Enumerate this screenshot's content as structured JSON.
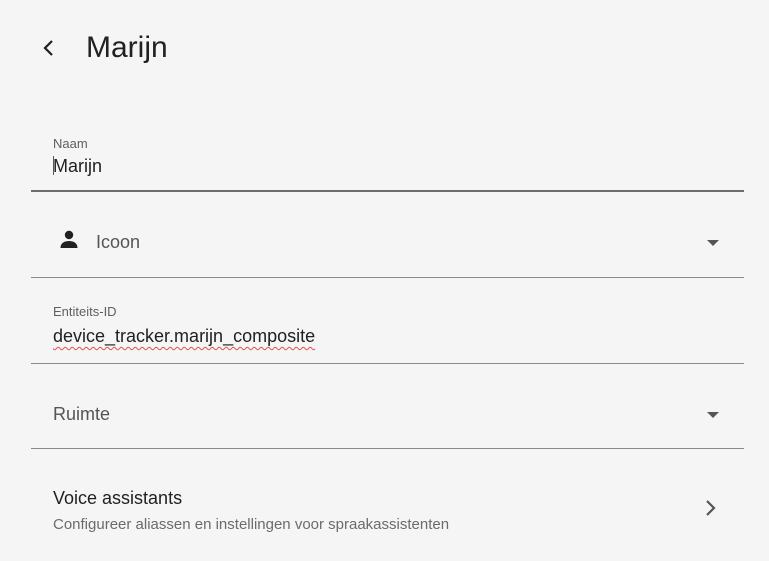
{
  "header": {
    "title": "Marijn"
  },
  "fields": {
    "name": {
      "label": "Naam",
      "value": "Marijn"
    },
    "icon": {
      "label": "Icoon"
    },
    "entity_id": {
      "label": "Entiteits-ID",
      "value": "device_tracker.marijn_composite"
    },
    "area": {
      "label": "Ruimte"
    }
  },
  "voice_assistants": {
    "title": "Voice assistants",
    "subtitle": "Configureer aliassen en instellingen voor spraakassistenten"
  },
  "icons": {
    "back": "chevron-left-icon",
    "icon_field": "account-icon",
    "dropdown": "menu-down-icon",
    "forward": "chevron-right-icon"
  }
}
